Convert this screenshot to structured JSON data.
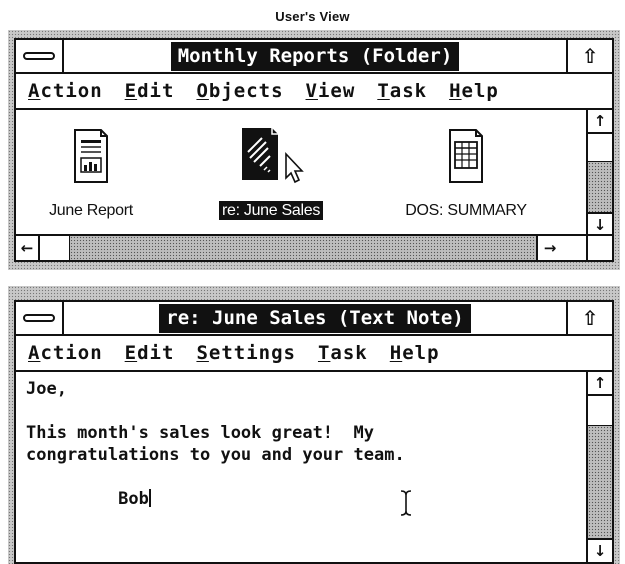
{
  "caption": "User's View",
  "folder_window": {
    "title": "Monthly Reports (Folder)",
    "maximize_glyph": "⇧",
    "menu": [
      {
        "label": "Action",
        "u": "A",
        "rest": "ction"
      },
      {
        "label": "Edit",
        "u": "E",
        "rest": "dit"
      },
      {
        "label": "Objects",
        "u": "O",
        "rest": "bjects"
      },
      {
        "label": "View",
        "u": "V",
        "rest": "iew"
      },
      {
        "label": "Task",
        "u": "T",
        "rest": "ask"
      },
      {
        "label": "Help",
        "u": "H",
        "rest": "elp"
      }
    ],
    "items": [
      {
        "label": "June Report",
        "icon": "report-document-icon",
        "selected": false
      },
      {
        "label": "re: June Sales",
        "icon": "text-note-icon",
        "selected": true
      },
      {
        "label": "DOS: SUMMARY",
        "icon": "spreadsheet-icon",
        "selected": false
      }
    ],
    "scroll": {
      "up": "↑",
      "down": "↓",
      "left": "←",
      "right": "→"
    }
  },
  "note_window": {
    "title": "re: June Sales (Text Note)",
    "maximize_glyph": "⇧",
    "menu": [
      {
        "label": "Action",
        "u": "A",
        "rest": "ction"
      },
      {
        "label": "Edit",
        "u": "E",
        "rest": "dit"
      },
      {
        "label": "Settings",
        "u": "S",
        "rest": "ettings"
      },
      {
        "label": "Task",
        "u": "T",
        "rest": "ask"
      },
      {
        "label": "Help",
        "u": "H",
        "rest": "elp"
      }
    ],
    "lines": [
      "Joe,",
      "",
      "This month's sales look great!  My",
      "congratulations to you and your team.",
      "",
      "         Bob"
    ],
    "scroll": {
      "up": "↑",
      "down": "↓"
    }
  }
}
